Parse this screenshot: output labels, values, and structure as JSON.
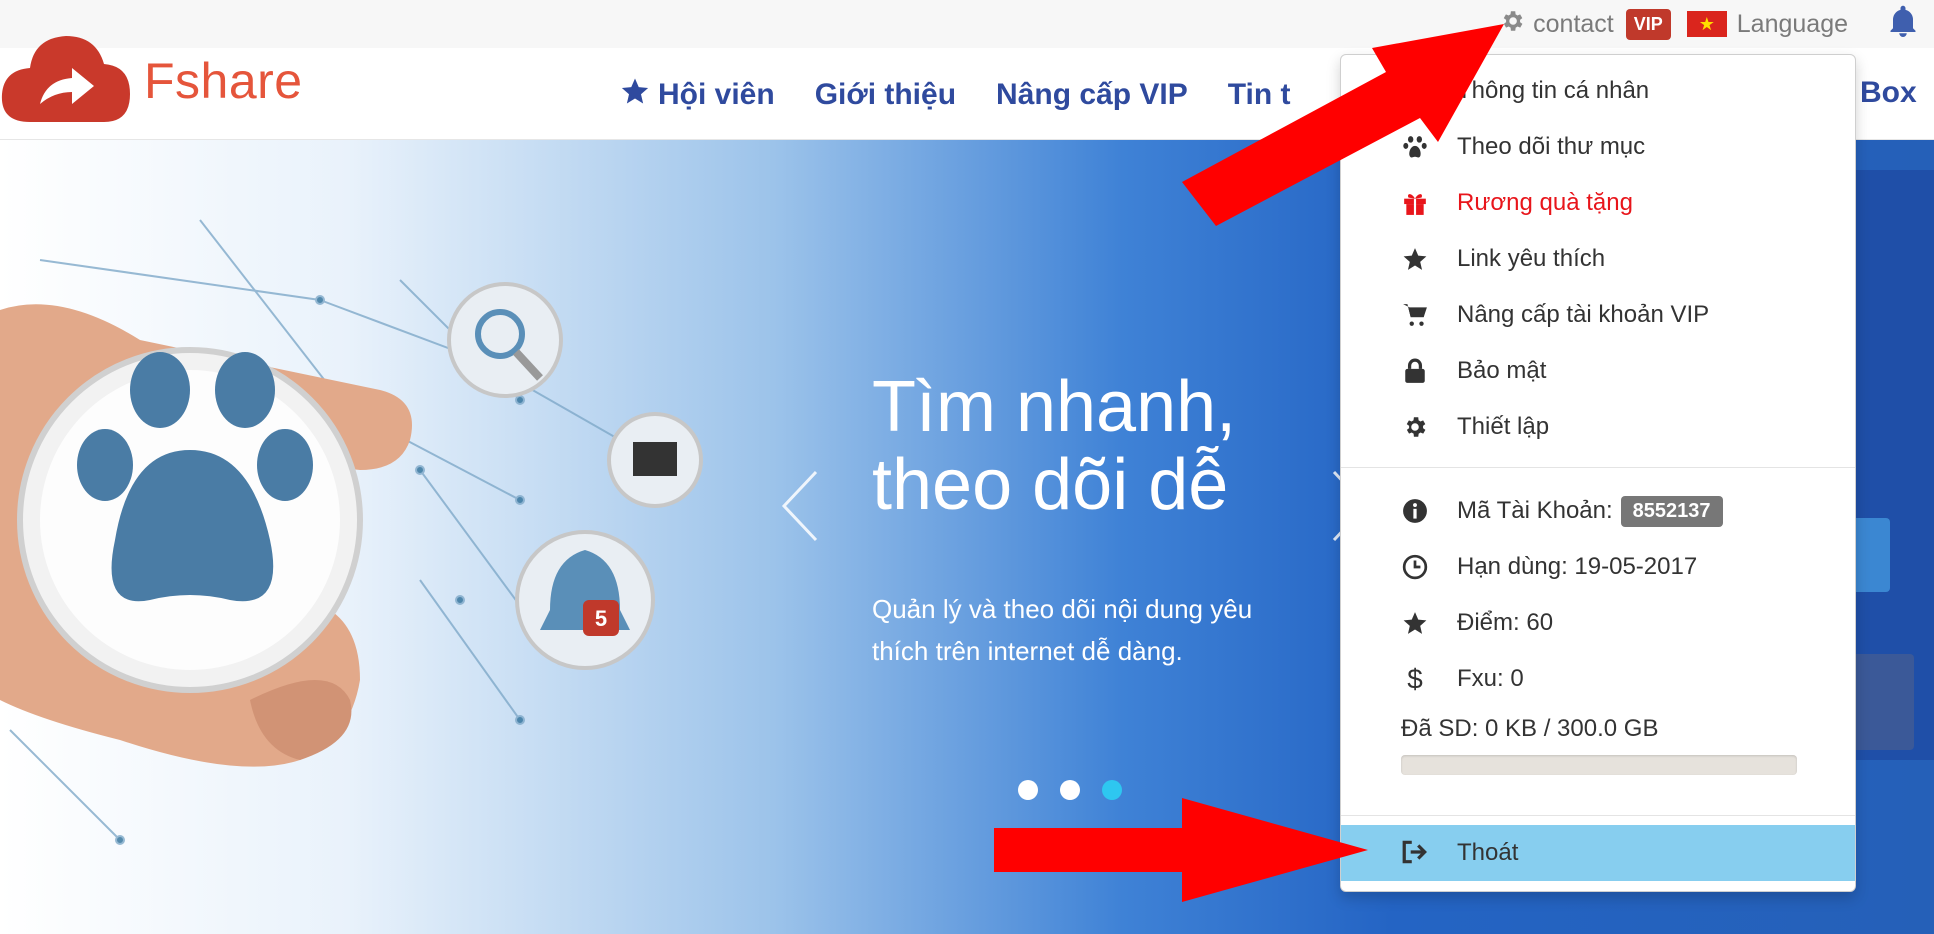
{
  "topbar": {
    "contact_label": "contact",
    "vip_badge": "VIP",
    "language_label": "Language",
    "flag_star": "★"
  },
  "header": {
    "logo_text": "Fshare",
    "nav": [
      {
        "label": "Hội viên",
        "icon": "star-icon"
      },
      {
        "label": "Giới thiệu"
      },
      {
        "label": "Nâng cấp VIP"
      },
      {
        "label": "Tin t"
      }
    ],
    "nav_right_label": "Box"
  },
  "hero": {
    "title_line1": "Tìm nhanh,",
    "title_line2": "theo dõi dễ",
    "description": "Quản lý và theo dõi nội dung yêu thích trên internet dễ dàng.",
    "dots": 3,
    "active_dot": 3
  },
  "dropdown": {
    "items": [
      {
        "label": "Thông tin cá nhân",
        "icon": "user-icon"
      },
      {
        "label": "Theo dõi thư mục",
        "icon": "paw-icon"
      },
      {
        "label": "Rương quà tặng",
        "icon": "gift-icon",
        "color": "#e8151b"
      },
      {
        "label": "Link yêu thích",
        "icon": "star-icon"
      },
      {
        "label": "Nâng cấp tài khoản VIP",
        "icon": "cart-icon"
      },
      {
        "label": "Bảo mật",
        "icon": "lock-icon"
      },
      {
        "label": "Thiết lập",
        "icon": "gear-icon"
      }
    ],
    "account_id_label": "Mã Tài Khoản:",
    "account_id": "8552137",
    "expiry_label": "Hạn dùng: 19-05-2017",
    "points_label": "Điểm: 60",
    "fxu_label": "Fxu: 0",
    "usage_label": "Đã SD: 0 KB / 300.0 GB",
    "usage_fraction": 0,
    "logout_label": "Thoát"
  },
  "colors": {
    "nav_text": "#2f4a9e",
    "vip_badge": "#c0392b",
    "logout_highlight": "#87ceef",
    "gift_text": "#e8151b",
    "annotation_arrow": "#ff0000"
  }
}
